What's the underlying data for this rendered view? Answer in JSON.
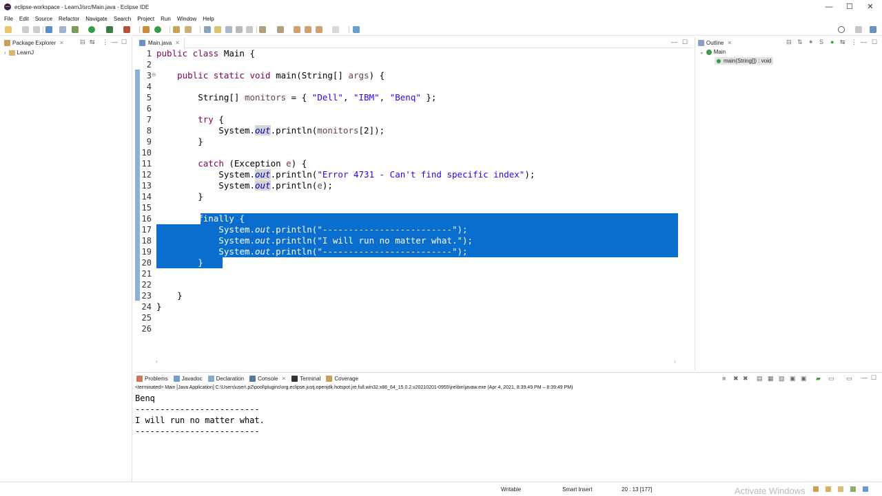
{
  "window": {
    "title": "eclipse-workspace - LearnJ/src/Main.java - Eclipse IDE",
    "min": "—",
    "max": "☐",
    "close": "✕"
  },
  "menu": [
    "File",
    "Edit",
    "Source",
    "Refactor",
    "Navigate",
    "Search",
    "Project",
    "Run",
    "Window",
    "Help"
  ],
  "left_panel": {
    "tab": "Package Explorer",
    "tree": [
      {
        "label": "LearnJ",
        "expanded": false
      }
    ]
  },
  "editor": {
    "tab": "Main.java",
    "line_numbers": [
      "1",
      "2",
      "3",
      "4",
      "5",
      "6",
      "7",
      "8",
      "9",
      "10",
      "11",
      "12",
      "13",
      "14",
      "15",
      "16",
      "17",
      "18",
      "19",
      "20",
      "21",
      "22",
      "23",
      "24",
      "25",
      "26"
    ],
    "fold_marker": "⊖",
    "lines": {
      "l1a": "public class ",
      "l1b": "Main {",
      "l3a": "    public static void ",
      "l3b": "main(String[] ",
      "l3c": "args",
      "l3d": ") {",
      "l5a": "        String[] ",
      "l5b": "monitors",
      "l5c": " = { ",
      "l5d": "\"Dell\"",
      "l5e": ", ",
      "l5f": "\"IBM\"",
      "l5g": ", ",
      "l5h": "\"Benq\"",
      "l5i": " };",
      "l7a": "        ",
      "l7b": "try",
      "l7c": " {",
      "l8a": "            System.",
      "l8b": "out",
      "l8c": ".println(",
      "l8d": "monitors",
      "l8e": "[2]);",
      "l9": "        }",
      "l11a": "        ",
      "l11b": "catch",
      "l11c": " (Exception ",
      "l11d": "e",
      "l11e": ") {",
      "l12a": "            System.",
      "l12b": "out",
      "l12c": ".println(",
      "l12d": "\"Error 4731 - Can't find specific index\"",
      "l12e": ");",
      "l13a": "            System.",
      "l13b": "out",
      "l13c": ".println(",
      "l13d": "e",
      "l13e": ");",
      "l14": "        }",
      "l16a": "        ",
      "l16b": "finally",
      "l16c": " {",
      "l17a": "            System.",
      "l17b": "out",
      "l17c": ".println(",
      "l17d": "\"-------------------------\"",
      "l17e": ");",
      "l18a": "            System.",
      "l18b": "out",
      "l18c": ".println(",
      "l18d": "\"I will run no matter what.\"",
      "l18e": ");",
      "l19a": "            System.",
      "l19b": "out",
      "l19c": ".println(",
      "l19d": "\"-------------------------\"",
      "l19e": ");",
      "l20": "        }",
      "l23": "    }",
      "l24": "}"
    }
  },
  "outline": {
    "tab": "Outline",
    "class": "Main",
    "method": "main(String[]) : void"
  },
  "console_panel": {
    "tabs": [
      "Problems",
      "Javadoc",
      "Declaration",
      "Console",
      "Terminal",
      "Coverage"
    ],
    "header": "<terminated> Main [Java Application] C:\\Users\\user\\.p2\\pool\\plugins\\org.eclipse.justj.openjdk.hotspot.jre.full.win32.x86_64_15.0.2.v20210201-0955\\jre\\bin\\javaw.exe  (Apr 4, 2021, 8:39:49 PM – 8:39:49 PM)",
    "output": [
      "Benq",
      "-------------------------",
      "I will run no matter what.",
      "-------------------------"
    ]
  },
  "status": {
    "writable": "Writable",
    "insert": "Smart Insert",
    "position": "20 : 13 [177]",
    "watermark": "Activate Windows"
  },
  "colors": {
    "selection": "#0a6ecf",
    "keyword": "#7f0055",
    "string": "#2a00ff",
    "field": "#0000c0"
  }
}
